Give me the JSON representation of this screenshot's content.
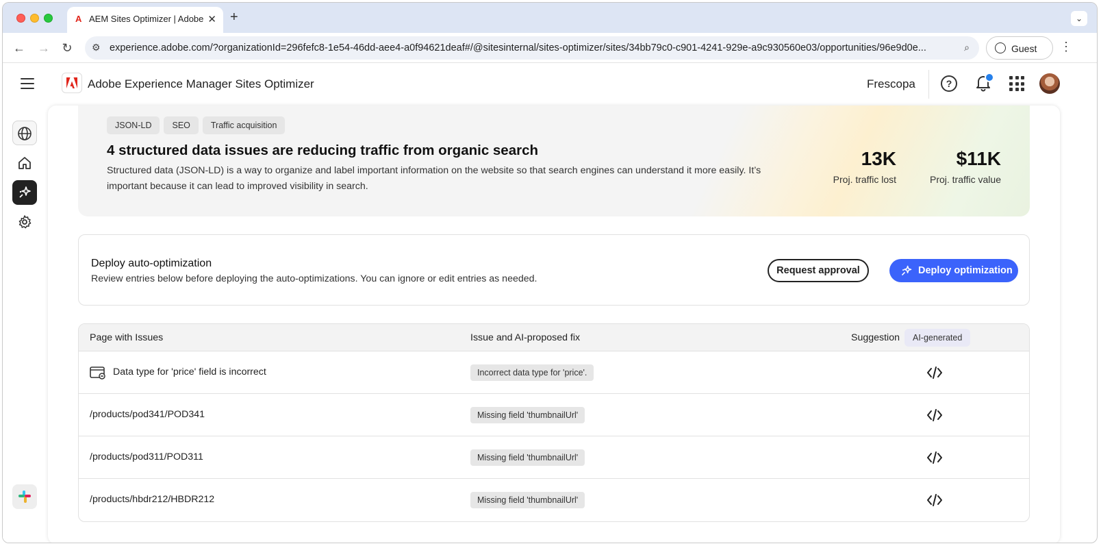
{
  "browser": {
    "tab_title": "AEM Sites Optimizer | Adobe",
    "url": "experience.adobe.com/?organizationId=296fefc8-1e54-46dd-aee4-a0f94621deaf#/@sitesinternal/sites-optimizer/sites/34bb79c0-c901-4241-929e-a9c930560e03/opportunities/96e9d0e...",
    "profile_label": "Guest"
  },
  "header": {
    "app_title": "Adobe Experience Manager Sites Optimizer",
    "org_name": "Frescopa",
    "notification_color": "#2680eb"
  },
  "rail": {
    "items": [
      "globe-icon",
      "home-icon",
      "opportunities-icon",
      "settings-icon",
      "slack-icon"
    ],
    "active": "opportunities-icon"
  },
  "hero": {
    "tags": [
      "JSON-LD",
      "SEO",
      "Traffic acquisition"
    ],
    "title": "4 structured data issues are reducing traffic from organic search",
    "description": "Structured data (JSON-LD) is a way to organize and label important information on the website so that search engines can understand it more easily. It’s important because it can lead to improved visibility in search.",
    "metrics": [
      {
        "value": "13K",
        "label": "Proj. traffic lost"
      },
      {
        "value": "$11K",
        "label": "Proj. traffic value"
      }
    ]
  },
  "deploy": {
    "title": "Deploy auto-optimization",
    "subtitle": "Review entries below before deploying the auto-optimizations. You can ignore or edit entries as needed.",
    "request_label": "Request approval",
    "deploy_label": "Deploy optimization",
    "accent_color": "#3b63fb"
  },
  "table": {
    "columns": [
      "Page with Issues",
      "Issue and AI-proposed fix",
      "Suggestion"
    ],
    "ai_badge": "AI-generated",
    "rows": [
      {
        "page": "Data type for 'price' field is incorrect",
        "issue": "Incorrect data type for 'price'."
      },
      {
        "page": "/products/pod341/POD341",
        "issue": "Missing field 'thumbnailUrl'"
      },
      {
        "page": "/products/pod311/POD311",
        "issue": "Missing field 'thumbnailUrl'"
      },
      {
        "page": "/products/hbdr212/HBDR212",
        "issue": "Missing field 'thumbnailUrl'"
      }
    ]
  }
}
